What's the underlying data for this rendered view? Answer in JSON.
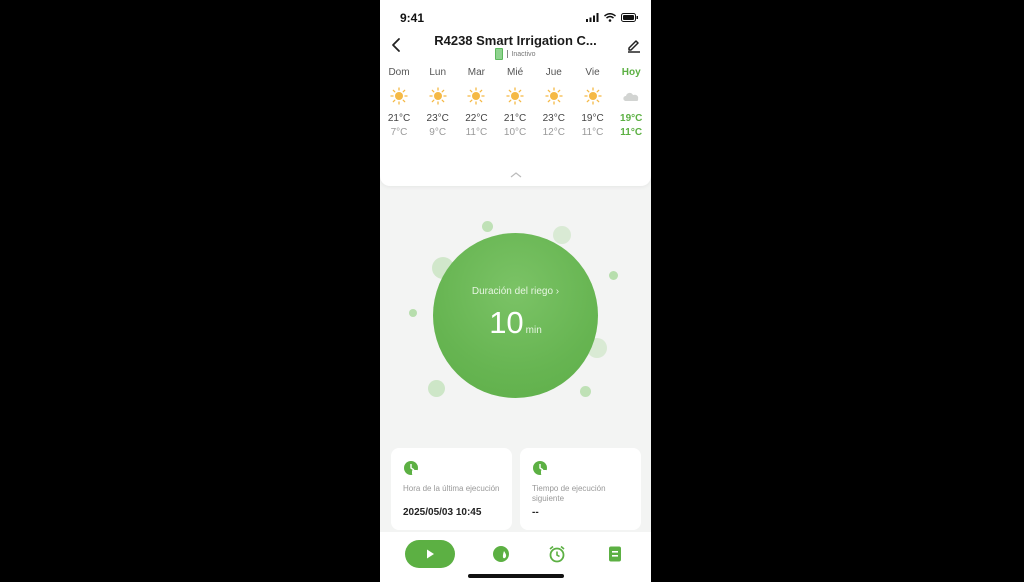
{
  "status_bar": {
    "time": "9:41"
  },
  "header": {
    "title": "R4238 Smart Irrigation C...",
    "status": "Inactivo"
  },
  "forecast": [
    {
      "day": "Dom",
      "icon": "sun-icon",
      "high": "21°C",
      "low": "7°C"
    },
    {
      "day": "Lun",
      "icon": "sun-icon",
      "high": "23°C",
      "low": "9°C"
    },
    {
      "day": "Mar",
      "icon": "sun-icon",
      "high": "22°C",
      "low": "11°C"
    },
    {
      "day": "Mié",
      "icon": "sun-icon",
      "high": "21°C",
      "low": "10°C"
    },
    {
      "day": "Jue",
      "icon": "sun-icon",
      "high": "23°C",
      "low": "12°C"
    },
    {
      "day": "Vie",
      "icon": "sun-icon",
      "high": "19°C",
      "low": "11°C"
    },
    {
      "day": "Hoy",
      "icon": "cloud-icon",
      "high": "19°C",
      "low": "11°C"
    }
  ],
  "irrigation": {
    "label": "Duración del riego",
    "value": "10",
    "unit": "min"
  },
  "cards": {
    "last_run": {
      "label": "Hora de la última ejecución",
      "value": "2025/05/03 10:45"
    },
    "next_run": {
      "label": "Tiempo de ejecución siguiente",
      "value": "--"
    }
  },
  "colors": {
    "accent": "#5cb043",
    "sun": "#f5b945",
    "background": "#f3f4f3"
  },
  "bottom_bar": {
    "icons": [
      "play-icon",
      "water-drop-icon",
      "alarm-clock-icon",
      "document-icon"
    ]
  }
}
